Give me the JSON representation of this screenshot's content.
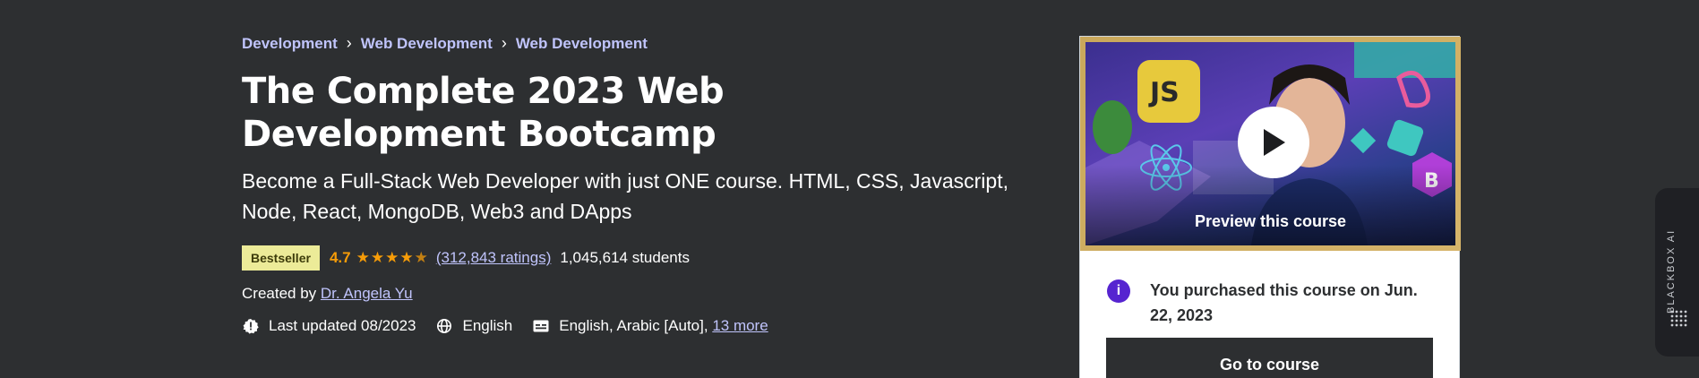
{
  "breadcrumb": [
    "Development",
    "Web Development",
    "Web Development"
  ],
  "course": {
    "title": "The Complete 2023 Web Development Bootcamp",
    "subtitle": "Become a Full-Stack Web Developer with just ONE course. HTML, CSS, Javascript, Node, React, MongoDB, Web3 and DApps",
    "badge": "Bestseller",
    "rating": "4.7",
    "stars": 4.5,
    "ratings_count": "(312,843 ratings)",
    "students": "1,045,614 students",
    "created_by_label": "Created by",
    "instructor": "Dr. Angela Yu",
    "last_updated": "Last updated 08/2023",
    "language": "English",
    "captions": "English, Arabic [Auto],",
    "captions_more": "13 more"
  },
  "card": {
    "preview_label": "Preview this course",
    "purchase_notice": "You purchased this course on Jun. 22, 2023",
    "go_button": "Go to course"
  },
  "side_tab": {
    "label": "BLACKBOX AI"
  },
  "colors": {
    "background": "#2d2f31",
    "link": "#c0c4fc",
    "star": "#f69c08",
    "badge": "#eceb98",
    "accent": "#5624d0"
  },
  "icons": [
    "chevron-right-icon",
    "star-icon",
    "alert-badge-icon",
    "globe-icon",
    "captions-icon",
    "play-icon",
    "info-icon"
  ]
}
